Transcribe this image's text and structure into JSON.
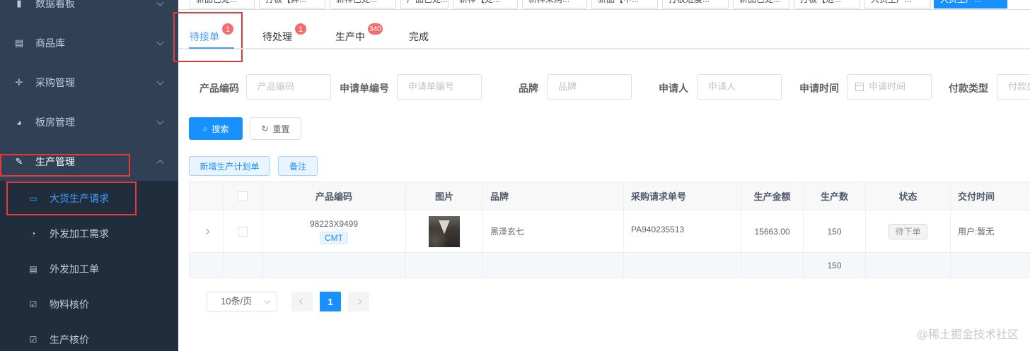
{
  "sidebar": {
    "items": [
      {
        "label": "数据看板",
        "icon": "bar-chart-icon"
      },
      {
        "label": "商品库",
        "icon": "document-icon"
      },
      {
        "label": "采购管理",
        "icon": "move-icon"
      },
      {
        "label": "板房管理",
        "icon": "globe-icon"
      },
      {
        "label": "生产管理",
        "icon": "edit-icon"
      }
    ],
    "subitems": [
      {
        "label": "大货生产请求",
        "icon": "card-icon"
      },
      {
        "label": "外发加工需求",
        "icon": "dashboard-icon"
      },
      {
        "label": "外发加工单",
        "icon": "document-icon"
      },
      {
        "label": "物料核价",
        "icon": "checkbox-icon"
      },
      {
        "label": "生产核价",
        "icon": "checkbox-icon"
      }
    ]
  },
  "tags": [
    "新品已处...",
    "打板【异...",
    "新样已处...",
    "产品已处...",
    "新样【处...",
    "新样采购...",
    "新品【中...",
    "打板进度...",
    "新品已处...",
    "打板【进...",
    "大货生产...",
    "大货生产..."
  ],
  "status_tabs": [
    {
      "label": "待接单",
      "badge": "1"
    },
    {
      "label": "待处理",
      "badge": "1"
    },
    {
      "label": "生产中",
      "badge": "340"
    },
    {
      "label": "完成",
      "badge": ""
    }
  ],
  "filters": [
    {
      "label": "产品编码",
      "placeholder": "产品编码"
    },
    {
      "label": "申请单编号",
      "placeholder": "申请单编号"
    },
    {
      "label": "品牌",
      "placeholder": "品牌"
    },
    {
      "label": "申请人",
      "placeholder": "申请人"
    },
    {
      "label": "申请时间",
      "placeholder": "申请时间"
    },
    {
      "label": "付款类型",
      "placeholder": "付款类"
    }
  ],
  "buttons": {
    "search": "搜索",
    "reset": "重置",
    "add_plan": "新增生产计划单",
    "remark": "备注"
  },
  "table": {
    "headers": [
      "产品编码",
      "图片",
      "品牌",
      "采购请求单号",
      "生产金额",
      "生产数",
      "状态",
      "交付时间"
    ],
    "rows": [
      {
        "code": "98223X9499",
        "code_tag": "CMT",
        "brand": "黑泽玄七",
        "request_no": "PA940235513",
        "amount": "15663.00",
        "quantity": "150",
        "status": "待下单",
        "delivery": "用户:暂无"
      }
    ],
    "sum_quantity": "150"
  },
  "pagination": {
    "page_size": "10条/页",
    "current": "1"
  },
  "watermark": "@稀土掘金技术社区"
}
